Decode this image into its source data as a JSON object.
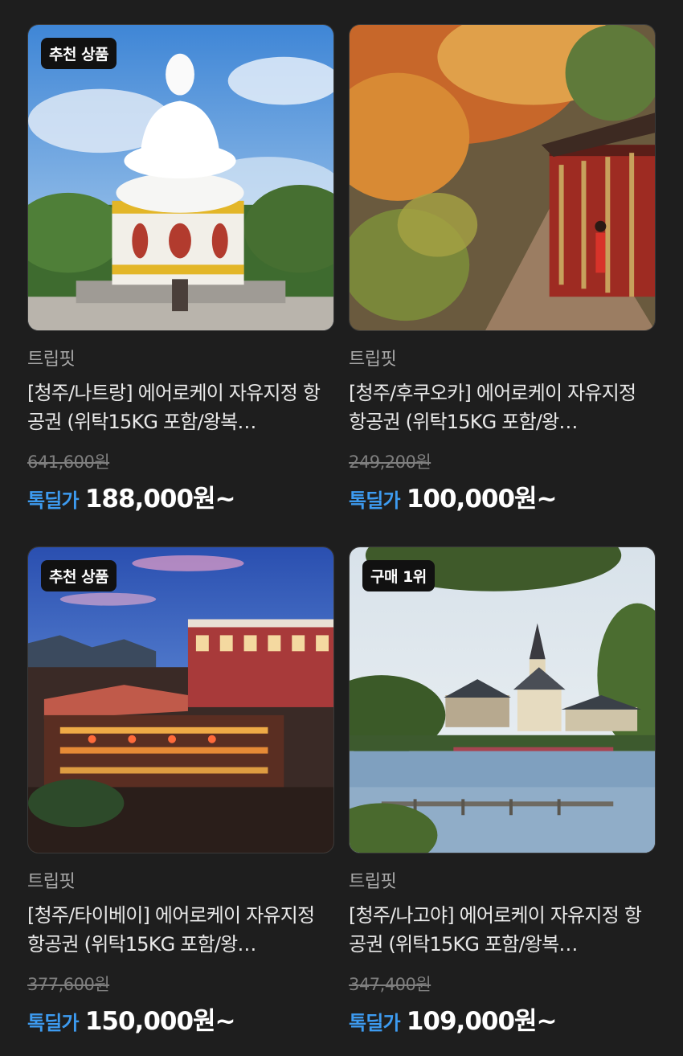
{
  "products": [
    {
      "badge": "추천 상품",
      "seller": "트립핏",
      "title": "[청주/나트랑] 에어로케이 자유지정 항공권 (위탁15KG 포함/왕복…",
      "original_price": "641,600원",
      "deal_label": "톡딜가",
      "price": "188,000원~"
    },
    {
      "badge": "",
      "seller": "트립핏",
      "title": "[청주/후쿠오카] 에어로케이 자유지정 항공권 (위탁15KG 포함/왕…",
      "original_price": "249,200원",
      "deal_label": "톡딜가",
      "price": "100,000원~"
    },
    {
      "badge": "추천 상품",
      "seller": "트립핏",
      "title": "[청주/타이베이] 에어로케이 자유지정 항공권 (위탁15KG 포함/왕…",
      "original_price": "377,600원",
      "deal_label": "톡딜가",
      "price": "150,000원~"
    },
    {
      "badge": "구매 1위",
      "seller": "트립핏",
      "title": "[청주/나고야] 에어로케이 자유지정 항공권 (위탁15KG 포함/왕복…",
      "original_price": "347,400원",
      "deal_label": "톡딜가",
      "price": "109,000원~"
    }
  ],
  "colors": {
    "background": "#1e1e1e",
    "deal_label": "#3d9bf0",
    "original_price": "#7f7f7f",
    "seller": "#a8a8a8"
  }
}
